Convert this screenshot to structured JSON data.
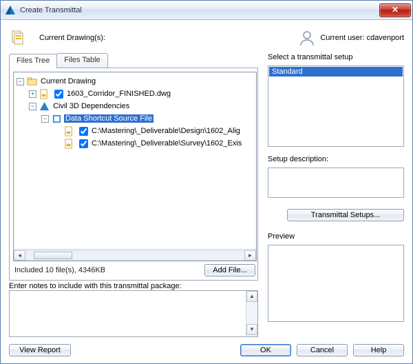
{
  "window": {
    "title": "Create Transmittal"
  },
  "header": {
    "drawings_label": "Current Drawing(s):",
    "user_label": "Current user: cdavenport"
  },
  "tabs": {
    "files_tree": "Files Tree",
    "files_table": "Files Table"
  },
  "tree": {
    "root": "Current Drawing",
    "dwg": "1603_Corridor_FINISHED.dwg",
    "deps": "Civil 3D Dependencies",
    "src": "Data Shortcut Source File",
    "f1": "C:\\Mastering\\_Deliverable\\Design\\1602_Alig",
    "f2": "C:\\Mastering\\_Deliverable\\Survey\\1602_Exis"
  },
  "status": {
    "included": "Included 10 file(s), 4346KB",
    "add_file": "Add  File..."
  },
  "notes": {
    "label": "Enter notes to include with this transmittal package:",
    "value": ""
  },
  "right": {
    "select_label": "Select a transmittal setup",
    "setup_item": "Standard",
    "desc_label": "Setup description:",
    "setups_btn": "Transmittal Setups...",
    "preview_label": "Preview"
  },
  "buttons": {
    "view_report": "View Report",
    "ok": "OK",
    "cancel": "Cancel",
    "help": "Help"
  }
}
